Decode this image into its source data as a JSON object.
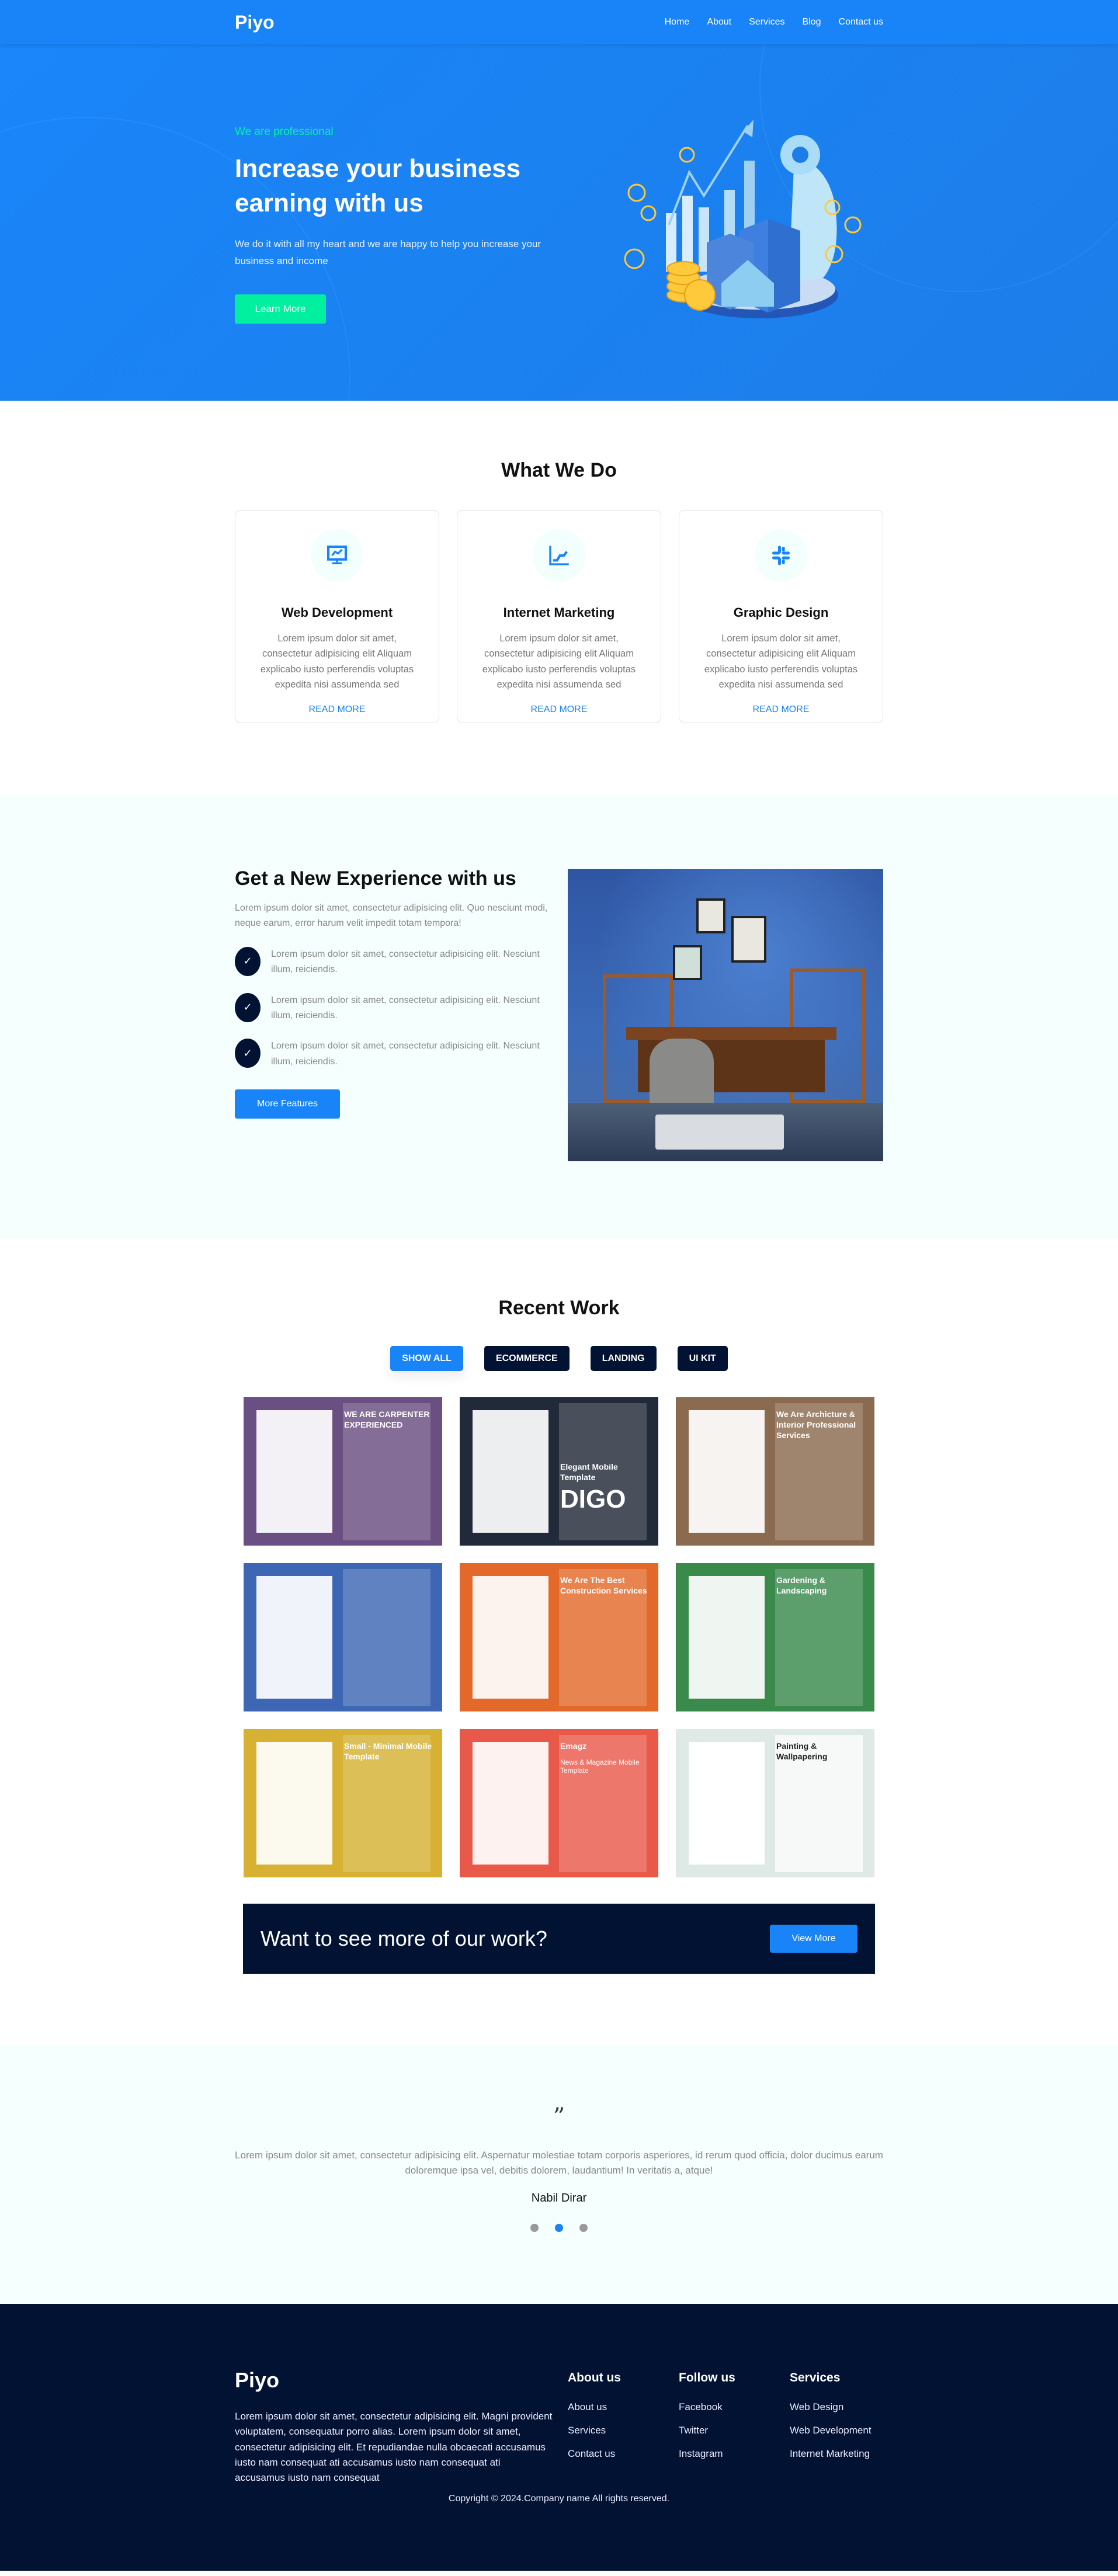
{
  "header": {
    "logo": "Piyo",
    "nav": [
      "Home",
      "About",
      "Services",
      "Blog",
      "Contact us"
    ]
  },
  "hero": {
    "tag": "We are professional",
    "title": "Increase your business earning with us",
    "desc": "We do it with all my heart and we are happy to help you increase your business and income",
    "cta": "Learn More",
    "illustration": "finance-growth-illustration"
  },
  "what": {
    "title": "What We Do",
    "cards": [
      {
        "icon": "monitor-chart-icon",
        "title": "Web Development",
        "text": "Lorem ipsum dolor sit amet, consectetur adipisicing elit Aliquam explicabo iusto perferendis voluptas expedita nisi assumenda sed",
        "link": "READ MORE"
      },
      {
        "icon": "line-chart-icon",
        "title": "Internet Marketing",
        "text": "Lorem ipsum dolor sit amet, consectetur adipisicing elit Aliquam explicabo iusto perferendis voluptas expedita nisi assumenda sed",
        "link": "READ MORE"
      },
      {
        "icon": "slack-icon",
        "title": "Graphic Design",
        "text": "Lorem ipsum dolor sit amet, consectetur adipisicing elit Aliquam explicabo iusto perferendis voluptas expedita nisi assumenda sed",
        "link": "READ MORE"
      }
    ]
  },
  "features": {
    "title": "Get a New Experience with us",
    "desc": "Lorem ipsum dolor sit amet, consectetur adipisicing elit. Quo nesciunt modi, neque earum, error harum velit impedit totam tempora!",
    "items": [
      "Lorem ipsum dolor sit amet, consectetur adipisicing elit. Nesciunt illum, reiciendis.",
      "Lorem ipsum dolor sit amet, consectetur adipisicing elit. Nesciunt illum, reiciendis.",
      "Lorem ipsum dolor sit amet, consectetur adipisicing elit. Nesciunt illum, reiciendis."
    ],
    "button": "More Features",
    "check_icon": "✓"
  },
  "recent": {
    "title": "Recent Work",
    "filters": [
      "SHOW ALL",
      "ECOMMERCE",
      "LANDING",
      "UI KIT"
    ],
    "active_filter": "SHOW ALL",
    "tiles": [
      {
        "bg": "#6a4f82",
        "caption": "WE ARE CARPENTER EXPERIENCED"
      },
      {
        "bg": "#212a39",
        "caption": "Elegant Mobile Template",
        "big": "DIGO"
      },
      {
        "bg": "#8a6b4f",
        "caption": "We Are Archicture & Interior Professional Services"
      },
      {
        "bg": "#3d67b4",
        "caption": ""
      },
      {
        "bg": "#e2692a",
        "caption": "We Are The Best Construction Services"
      },
      {
        "bg": "#3a8a4c",
        "caption": "Gardening & Landscaping"
      },
      {
        "bg": "#d6b133",
        "caption": "Small - Minimal Mobile Template"
      },
      {
        "bg": "#e8594a",
        "caption": "Emagz",
        "sub": "News & Magazine Mobile Template"
      },
      {
        "bg": "#dfe9e6",
        "caption": "Painting & Wallpapering"
      }
    ]
  },
  "cta": {
    "text": "Want to see more of our work?",
    "button": "View More"
  },
  "testimonial": {
    "quote_icon": "”",
    "text": "Lorem ipsum dolor sit amet, consectetur adipisicing elit. Aspernatur molestiae totam corporis asperiores, id rerum quod officia, dolor ducimus earum doloremque ipsa vel, debitis dolorem, laudantium! In veritatis a, atque!",
    "name": "Nabil Dirar",
    "dots": 3,
    "active_dot": 2
  },
  "footer": {
    "logo": "Piyo",
    "about": "Lorem ipsum dolor sit amet, consectetur adipisicing elit. Magni provident voluptatem, consequatur porro alias. Lorem ipsum dolor sit amet, consectetur adipisicing elit. Et repudiandae nulla obcaecati accusamus iusto nam consequat ati accusamus iusto nam consequat ati accusamus iusto nam consequat",
    "cols": [
      {
        "title": "About us",
        "links": [
          "About us",
          "Services",
          "Contact us"
        ]
      },
      {
        "title": "Follow us",
        "links": [
          "Facebook",
          "Twitter",
          "Instagram"
        ]
      },
      {
        "title": "Services",
        "links": [
          "Web Design",
          "Web Development",
          "Internet Marketing"
        ]
      }
    ],
    "copyright": "Copyright © 2024.Company name All rights reserved."
  },
  "colors": {
    "primary": "#1984f8",
    "accent": "#00f0a0",
    "dark": "#021233",
    "light_bg": "#f5fffd"
  }
}
